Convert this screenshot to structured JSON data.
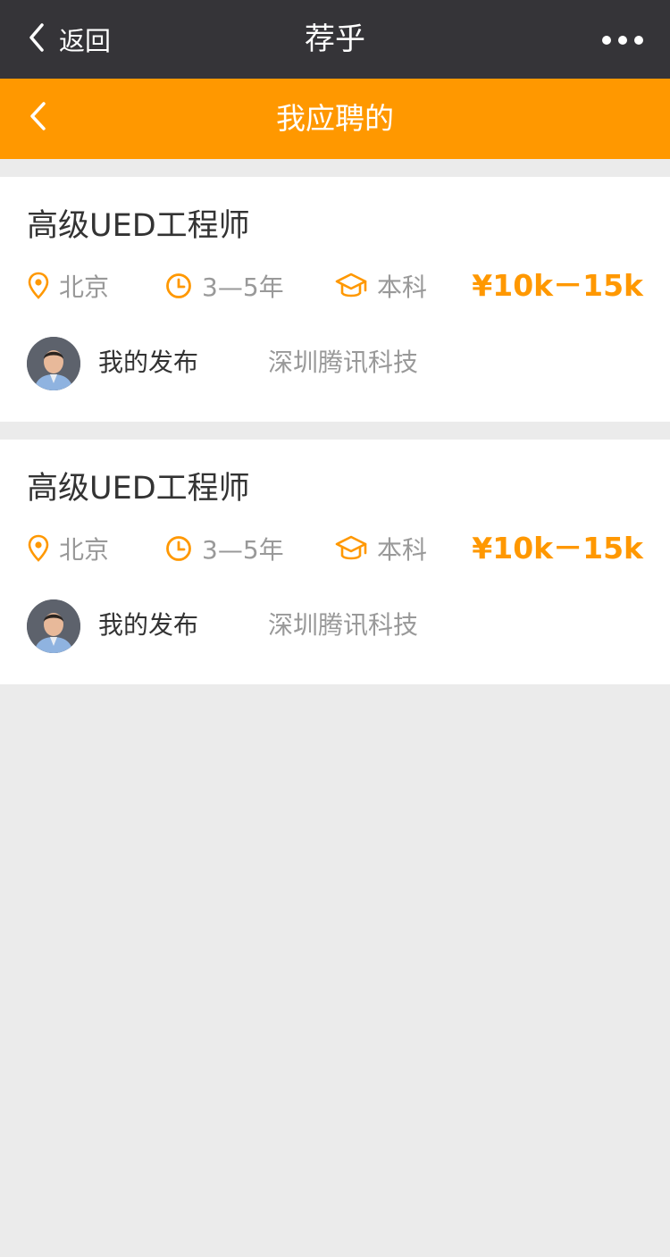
{
  "wechat_bar": {
    "back_label": "返回",
    "title": "荐乎"
  },
  "nav": {
    "title": "我应聘的"
  },
  "colors": {
    "accent": "#ff9800",
    "wechat_bar": "#353438",
    "background": "#ebebeb"
  },
  "jobs": [
    {
      "title": "高级UED工程师",
      "location": "北京",
      "experience": "3—5年",
      "education": "本科",
      "salary": "¥10k－15k",
      "poster": "我的发布",
      "company": "深圳腾讯科技"
    },
    {
      "title": "高级UED工程师",
      "location": "北京",
      "experience": "3—5年",
      "education": "本科",
      "salary": "¥10k－15k",
      "poster": "我的发布",
      "company": "深圳腾讯科技"
    }
  ]
}
